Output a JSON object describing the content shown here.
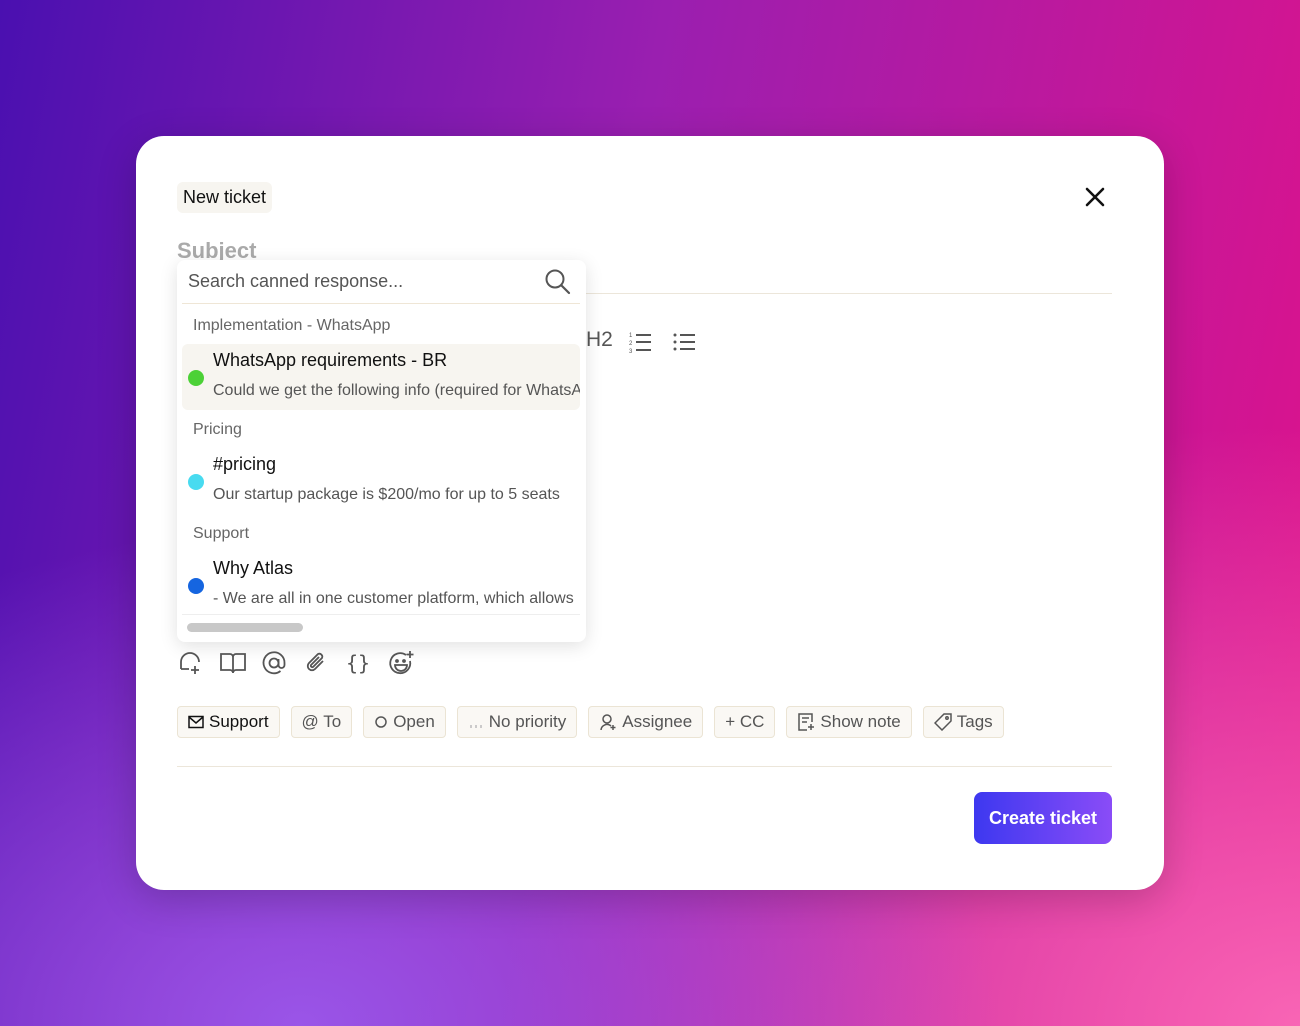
{
  "modal": {
    "title": "New ticket",
    "subject_placeholder": "Subject"
  },
  "canned": {
    "search_placeholder": "Search canned response...",
    "groups": [
      {
        "label": "Implementation - WhatsApp",
        "items": [
          {
            "name": "WhatsApp requirements - BR",
            "preview": "Could we get the following info (required for WhatsApp",
            "color": "#4cd137"
          }
        ]
      },
      {
        "label": "Pricing",
        "items": [
          {
            "name": "#pricing",
            "preview": "Our startup package is $200/mo for up to 5 seats",
            "color": "#48dbf0"
          }
        ]
      },
      {
        "label": "Support",
        "items": [
          {
            "name": "Why Atlas",
            "preview": "- We are all in one customer platform, which allows",
            "color": "#1565e0"
          }
        ]
      }
    ]
  },
  "format": {
    "h2": "H2"
  },
  "chips": {
    "inbox": "Support",
    "to": "@ To",
    "status": "Open",
    "priority": "No priority",
    "assignee": "Assignee",
    "cc": "+ CC",
    "note": "Show note",
    "tags": "Tags"
  },
  "actions": {
    "create": "Create ticket"
  },
  "colors": {
    "accent_start": "#3d38f0",
    "accent_end": "#8a4cf7"
  }
}
